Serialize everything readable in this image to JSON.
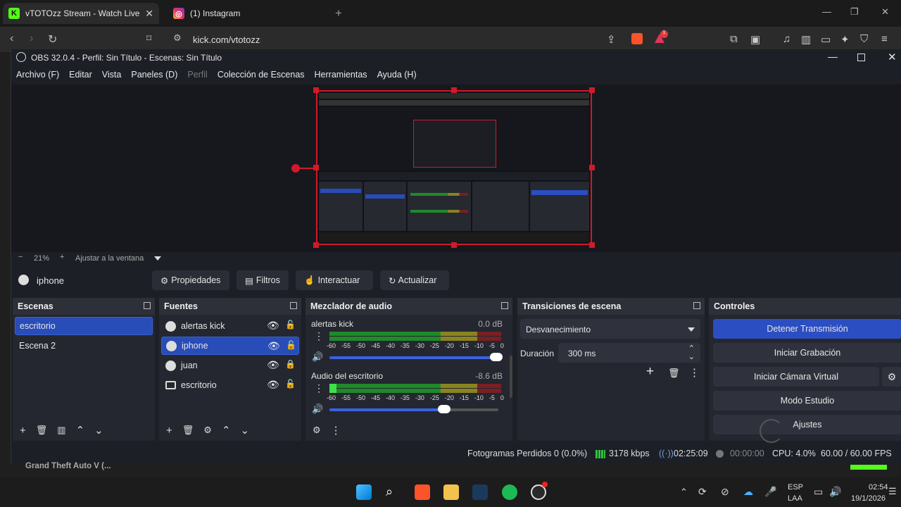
{
  "browser": {
    "tabs": [
      {
        "label": "vTOTOzz Stream - Watch Live on",
        "close": "✕",
        "active": true,
        "icon": "kick-favicon"
      },
      {
        "label": "(1) Instagram",
        "active": false,
        "icon": "instagram-favicon"
      }
    ],
    "new_tab": "+",
    "url": "kick.com/vtotozz",
    "window_controls": {
      "minimize": "—",
      "maximize": "❐",
      "close": "✕"
    }
  },
  "obs": {
    "title": "OBS 32.0.4 - Perfil: Sin Título - Escenas: Sin Título",
    "menu": [
      {
        "label": "Archivo (F)",
        "enabled": true
      },
      {
        "label": "Editar",
        "enabled": true
      },
      {
        "label": "Vista",
        "enabled": true
      },
      {
        "label": "Paneles (D)",
        "enabled": true
      },
      {
        "label": "Perfil",
        "enabled": false
      },
      {
        "label": "Colección de Escenas",
        "enabled": true
      },
      {
        "label": "Herramientas",
        "enabled": true
      },
      {
        "label": "Ayuda (H)",
        "enabled": true
      }
    ],
    "zoom": {
      "minus": "−",
      "value": "21%",
      "plus": "+",
      "fit_label": "Ajustar a la ventana"
    },
    "selected_source": "iphone",
    "source_toolbar": {
      "properties": "Propiedades",
      "filters": "Filtros",
      "interact": "Interactuar",
      "refresh": "Actualizar"
    },
    "scenes": {
      "title": "Escenas",
      "items": [
        {
          "label": "escritorio",
          "selected": true
        },
        {
          "label": "Escena 2",
          "selected": false
        }
      ]
    },
    "sources": {
      "title": "Fuentes",
      "items": [
        {
          "label": "alertas kick",
          "icon": "browser-globe-icon",
          "selected": false,
          "locked": false
        },
        {
          "label": "iphone",
          "icon": "browser-globe-icon",
          "selected": true,
          "locked": false
        },
        {
          "label": "juan",
          "icon": "browser-globe-icon",
          "selected": false,
          "locked": true
        },
        {
          "label": "escritorio",
          "icon": "display-icon",
          "selected": false,
          "locked": false
        }
      ]
    },
    "mixer": {
      "title": "Mezclador de audio",
      "scale": [
        "-60",
        "-55",
        "-50",
        "-45",
        "-40",
        "-35",
        "-30",
        "-25",
        "-20",
        "-15",
        "-10",
        "-5",
        "0"
      ],
      "channels": [
        {
          "name": "alertas kick",
          "db": "0.0 dB",
          "level": 0,
          "volume": 1.0
        },
        {
          "name": "Audio del escritorio",
          "db": "-8.6 dB",
          "level": 0.05,
          "volume": 0.68
        }
      ]
    },
    "transitions": {
      "title": "Transiciones de escena",
      "selected": "Desvanecimiento",
      "duration_label": "Duración",
      "duration_value": "300 ms"
    },
    "controls": {
      "title": "Controles",
      "buttons": [
        {
          "label": "Detener Transmisión",
          "primary": true
        },
        {
          "label": "Iniciar Grabación",
          "primary": false
        },
        {
          "label": "Iniciar Cámara Virtual",
          "primary": false
        },
        {
          "label": "Modo Estudio",
          "primary": false
        },
        {
          "label": "Ajustes",
          "primary": false
        }
      ]
    },
    "status": {
      "dropped_frames": "Fotogramas Perdidos 0 (0.0%)",
      "bitrate": "3178 kbps",
      "stream_time": "02:25:09",
      "rec_time": "00:00:00",
      "cpu": "CPU: 4.0%",
      "fps": "60.00 / 60.00 FPS"
    }
  },
  "behind_window_text": "Grand Theft Auto V (...",
  "taskbar": {
    "lang_top": "ESP",
    "lang_bottom": "LAA",
    "time": "02:54",
    "date": "19/1/2026"
  },
  "colors": {
    "accent": "#2b4ec2",
    "selection": "#284cb8",
    "meter_green": "#1f8a2a",
    "meter_yellow": "#8a8420",
    "meter_red": "#7a1f24",
    "bitrate_green": "#2fc33c"
  }
}
